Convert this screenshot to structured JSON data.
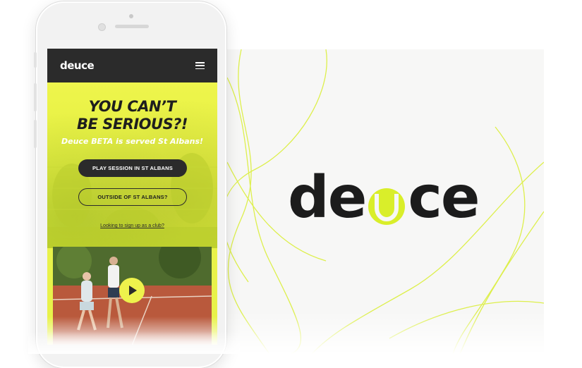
{
  "brand": {
    "logo_text": "deuce",
    "accent_color": "#d9ee2a",
    "dark_color": "#1c1c1c"
  },
  "phone": {
    "nav": {
      "logo_text": "deuce",
      "menu_icon": "hamburger-menu-icon"
    },
    "hero": {
      "title_line1": "YOU CAN’T",
      "title_line2": "BE SERIOUS?!",
      "subtitle": "Deuce BETA is served St Albans!",
      "primary_button": "PLAY SESSION IN ST ALBANS",
      "secondary_button": "OUTSIDE OF ST ALBANS?",
      "club_link": "Looking to sign up as a club?"
    },
    "video": {
      "play_icon": "play-icon"
    }
  }
}
